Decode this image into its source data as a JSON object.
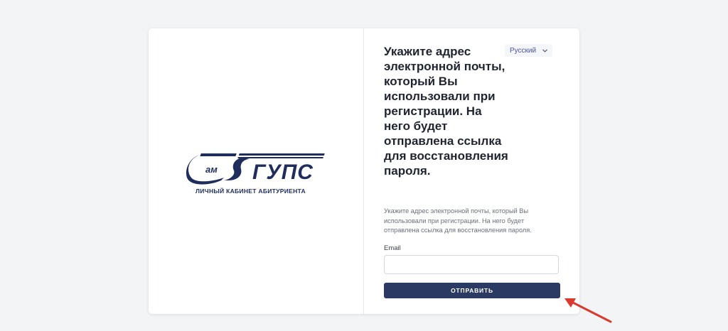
{
  "logo": {
    "mark_text": "ГУПС",
    "caption": "ЛИЧНЫЙ КАБИНЕТ АБИТУРИЕНТА"
  },
  "language": {
    "selected": "Русский",
    "icon": "chevron-down-icon"
  },
  "form": {
    "heading": "Укажите адрес электронной почты, который Вы использовали при регистрации. На него будет отправлена ссылка для восстановления пароля.",
    "description": "Укажите адрес электронной почты, который Вы использовали при регистрации. На него будет отправлена ссылка для восстановления пароля.",
    "email_label": "Email",
    "email_value": "",
    "email_placeholder": "",
    "submit_label": "ОТПРАВИТЬ"
  },
  "colors": {
    "primary": "#2b3a63",
    "logo": "#1f2d5c",
    "annotation_arrow": "#d93a2f",
    "background": "#f3f4f6"
  }
}
